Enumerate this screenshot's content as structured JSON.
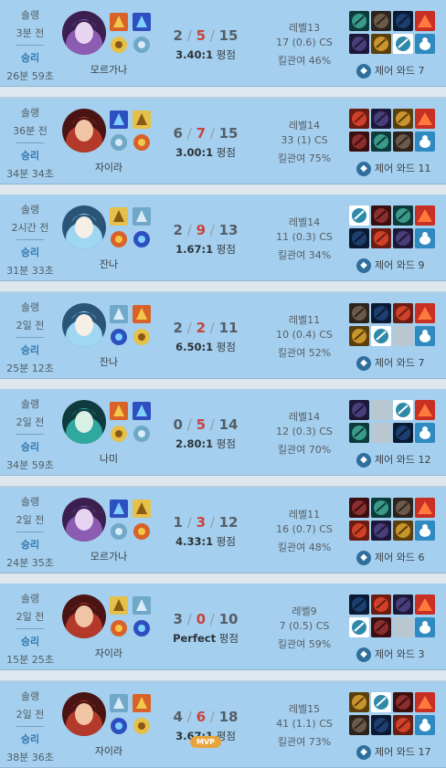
{
  "games": [
    {
      "queue": "솔랭",
      "ago": "3분 전",
      "result": "승리",
      "duration": "26분 59초",
      "champion": "모르가나",
      "champion_icon": "morgana-portrait",
      "kills": "2",
      "deaths": "5",
      "assists": "15",
      "ratio": "3.40:1",
      "ratio_suffix": "평점",
      "level": "레벨13",
      "cs": "17 (0.6) CS",
      "kp": "킬관여 46%",
      "ward": "제어 와드 7",
      "mvp": ""
    },
    {
      "queue": "솔랭",
      "ago": "36분 전",
      "result": "승리",
      "duration": "34분 34초",
      "champion": "자이라",
      "champion_icon": "zyra-portrait",
      "kills": "6",
      "deaths": "7",
      "assists": "15",
      "ratio": "3.00:1",
      "ratio_suffix": "평점",
      "level": "레벨14",
      "cs": "33 (1) CS",
      "kp": "킬관여 75%",
      "ward": "제어 와드 11",
      "mvp": ""
    },
    {
      "queue": "솔랭",
      "ago": "2시간 전",
      "result": "승리",
      "duration": "31분 33초",
      "champion": "잔나",
      "champion_icon": "janna-portrait",
      "kills": "2",
      "deaths": "9",
      "assists": "13",
      "ratio": "1.67:1",
      "ratio_suffix": "평점",
      "level": "레벨14",
      "cs": "11 (0.3) CS",
      "kp": "킬관여 34%",
      "ward": "제어 와드 9",
      "mvp": ""
    },
    {
      "queue": "솔랭",
      "ago": "2일 전",
      "result": "승리",
      "duration": "25분 12초",
      "champion": "잔나",
      "champion_icon": "janna-portrait",
      "kills": "2",
      "deaths": "2",
      "assists": "11",
      "ratio": "6.50:1",
      "ratio_suffix": "평점",
      "level": "레벨11",
      "cs": "10 (0.4) CS",
      "kp": "킬관여 52%",
      "ward": "제어 와드 7",
      "mvp": ""
    },
    {
      "queue": "솔랭",
      "ago": "2일 전",
      "result": "승리",
      "duration": "34분 59초",
      "champion": "나미",
      "champion_icon": "nami-portrait",
      "kills": "0",
      "deaths": "5",
      "assists": "14",
      "ratio": "2.80:1",
      "ratio_suffix": "평점",
      "level": "레벨14",
      "cs": "12 (0.3) CS",
      "kp": "킬관여 70%",
      "ward": "제어 와드 12",
      "mvp": ""
    },
    {
      "queue": "솔랭",
      "ago": "2일 전",
      "result": "승리",
      "duration": "24분 35초",
      "champion": "모르가나",
      "champion_icon": "morgana-portrait",
      "kills": "1",
      "deaths": "3",
      "assists": "12",
      "ratio": "4.33:1",
      "ratio_suffix": "평점",
      "level": "레벨11",
      "cs": "16 (0.7) CS",
      "kp": "킬관여 48%",
      "ward": "제어 와드 6",
      "mvp": ""
    },
    {
      "queue": "솔랭",
      "ago": "2일 전",
      "result": "승리",
      "duration": "15분 25초",
      "champion": "자이라",
      "champion_icon": "zyra-portrait",
      "kills": "3",
      "deaths": "0",
      "assists": "10",
      "ratio": "Perfect",
      "ratio_suffix": "평점",
      "level": "레벨9",
      "cs": "7 (0.5) CS",
      "kp": "킬관여 59%",
      "ward": "제어 와드 3",
      "mvp": ""
    },
    {
      "queue": "솔랭",
      "ago": "2일 전",
      "result": "승리",
      "duration": "38분 36초",
      "champion": "자이라",
      "champion_icon": "zyra-portrait",
      "kills": "4",
      "deaths": "6",
      "assists": "18",
      "ratio": "3.67:1",
      "ratio_suffix": "평점",
      "level": "레벨15",
      "cs": "41 (1.1) CS",
      "kp": "킬관여 73%",
      "ward": "제어 와드 17",
      "mvp": "MVP"
    }
  ],
  "ward_icon": "control-ward-icon",
  "colors": {
    "row_bg": "#a5cfee",
    "win_text": "#2e78b0",
    "death_red": "#c6443e",
    "mvp_badge": "#e8a43b"
  }
}
